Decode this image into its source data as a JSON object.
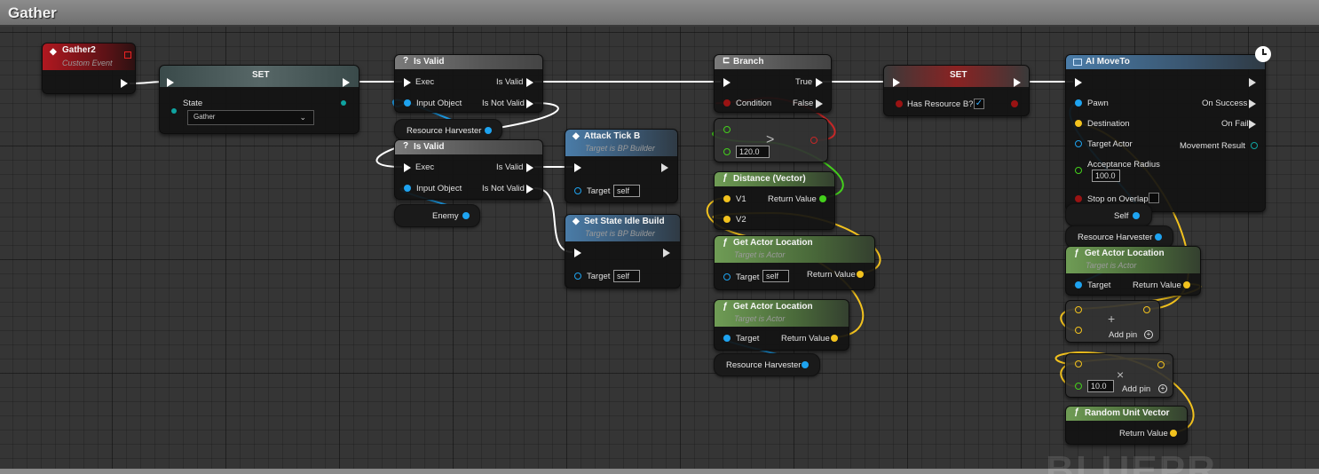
{
  "window": {
    "title": "Gather",
    "watermark": "BLUEPR"
  },
  "nodes": {
    "gather2": {
      "title": "Gather2",
      "subtitle": "Custom Event"
    },
    "set_state": {
      "title": "SET",
      "pin_label": "State",
      "value": "Gather"
    },
    "is_valid_1": {
      "title": "Is Valid",
      "exec": "Exec",
      "is_valid": "Is Valid",
      "input": "Input Object",
      "not_valid": "Is Not Valid"
    },
    "var_resource_harvester_1": {
      "label": "Resource Harvester"
    },
    "is_valid_2": {
      "title": "Is Valid",
      "exec": "Exec",
      "is_valid": "Is Valid",
      "input": "Input Object",
      "not_valid": "Is Not Valid"
    },
    "var_enemy": {
      "label": "Enemy"
    },
    "attack_tick": {
      "title": "Attack Tick B",
      "subtitle": "Target is BP Builder",
      "target": "Target",
      "target_value": "self"
    },
    "set_state_idle": {
      "title": "Set State Idle Build",
      "subtitle": "Target is BP Builder",
      "target": "Target",
      "target_value": "self"
    },
    "branch": {
      "title": "Branch",
      "true": "True",
      "condition": "Condition",
      "false": "False"
    },
    "compare": {
      "op": ">",
      "value": "120.0"
    },
    "distance": {
      "title": "Distance (Vector)",
      "v1": "V1",
      "v2": "V2",
      "ret": "Return Value"
    },
    "get_actor_loc_1": {
      "title": "Get Actor Location",
      "subtitle": "Target is Actor",
      "target": "Target",
      "target_value": "self",
      "ret": "Return Value"
    },
    "get_actor_loc_2": {
      "title": "Get Actor Location",
      "subtitle": "Target is Actor",
      "target": "Target",
      "ret": "Return Value"
    },
    "var_resource_harvester_2": {
      "label": "Resource Harvester"
    },
    "set_has_resource": {
      "title": "SET",
      "pin_label": "Has Resource B?",
      "checked": "✓"
    },
    "ai_moveto": {
      "title": "AI MoveTo",
      "pawn": "Pawn",
      "on_success": "On Success",
      "destination": "Destination",
      "on_fail": "On Fail",
      "target_actor": "Target Actor",
      "movement_result": "Movement Result",
      "acceptance_radius": "Acceptance Radius",
      "radius_value": "100.0",
      "stop_on_overlap": "Stop on Overlap"
    },
    "var_self": {
      "label": "Self"
    },
    "var_resource_harvester_3": {
      "label": "Resource Harvester"
    },
    "get_actor_loc_3": {
      "title": "Get Actor Location",
      "subtitle": "Target is Actor",
      "target": "Target",
      "ret": "Return Value"
    },
    "add_node": {
      "op": "+",
      "add_pin": "Add pin"
    },
    "mult_node": {
      "op": "×",
      "value": "10.0",
      "add_pin": "Add pin"
    },
    "random_unit_vector": {
      "title": "Random Unit Vector",
      "ret": "Return Value"
    }
  },
  "colors": {
    "exec": "#ffffff",
    "object": "#1ea3f0",
    "vector": "#f2c21e",
    "float": "#44d01c",
    "bool": "#9a1313",
    "enum": "#0fa3a0"
  }
}
